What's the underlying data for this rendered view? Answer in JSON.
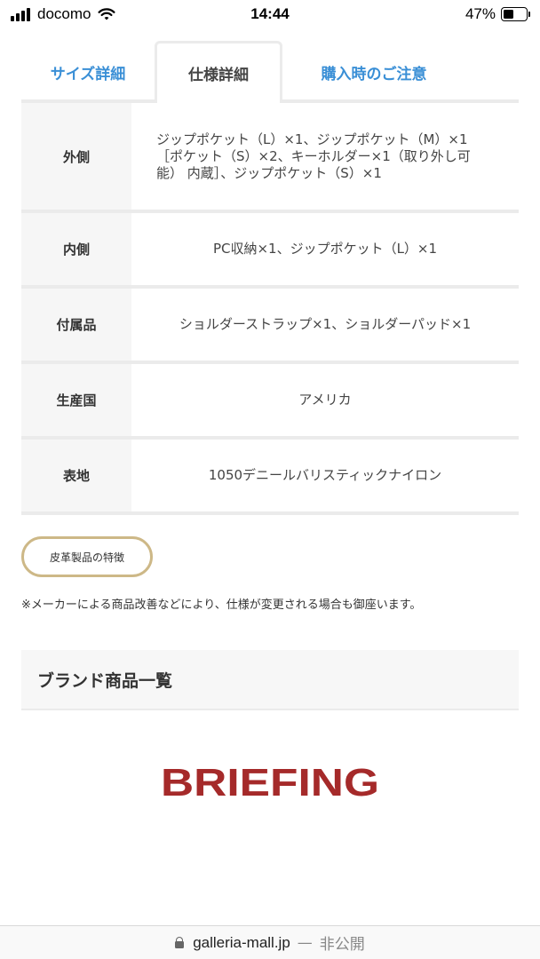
{
  "status_bar": {
    "carrier": "docomo",
    "time": "14:44",
    "battery_percent": "47%",
    "battery_level": 0.47
  },
  "tabs": [
    {
      "label": "サイズ詳細",
      "active": false
    },
    {
      "label": "仕様詳細",
      "active": true
    },
    {
      "label": "購入時のご注意",
      "active": false
    }
  ],
  "specs": [
    {
      "label": "外側",
      "value": "ジップポケット（L）×1、ジップポケット（M）×1［ポケット（S）×2、キーホルダー×1（取り外し可能） 内蔵］、ジップポケット（S）×1"
    },
    {
      "label": "内側",
      "value": "PC収納×1、ジップポケット（L）×1"
    },
    {
      "label": "付属品",
      "value": "ショルダーストラップ×1、ショルダーパッド×1"
    },
    {
      "label": "生産国",
      "value": "アメリカ"
    },
    {
      "label": "表地",
      "value": "1050デニールバリスティックナイロン"
    }
  ],
  "leather_button_label": "皮革製品の特徴",
  "notice": "※メーカーによる商品改善などにより、仕様が変更される場合も御座います。",
  "brand_section_title": "ブランド商品一覧",
  "brand_logo_text": "BRIEFING",
  "brand_logo_color": "#a52a2a",
  "accent_color": "#3a8fd6",
  "url_bar": {
    "host": "galleria-mall.jp",
    "separator": "—",
    "status": "非公開"
  }
}
